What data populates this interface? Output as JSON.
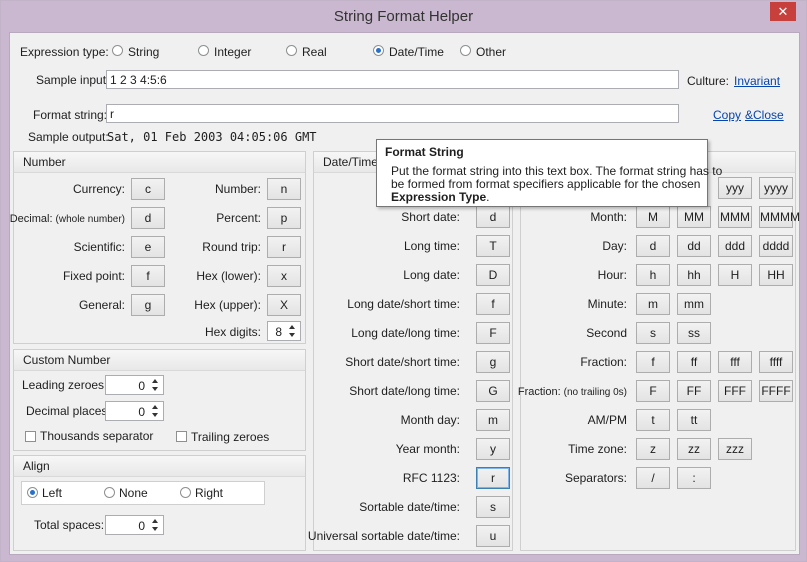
{
  "window": {
    "title": "String Format Helper",
    "close_glyph": "✕"
  },
  "expression": {
    "label": "Expression type:",
    "options": [
      {
        "label": "String",
        "selected": false
      },
      {
        "label": "Integer",
        "selected": false
      },
      {
        "label": "Real",
        "selected": false
      },
      {
        "label": "Date/Time",
        "selected": true
      },
      {
        "label": "Other",
        "selected": false
      }
    ]
  },
  "sample_input": {
    "label": "Sample input:",
    "value": "1 2 3 4:5:6"
  },
  "culture": {
    "label": "Culture:",
    "value": "Invariant"
  },
  "format_string": {
    "label": "Format string:",
    "value": "r"
  },
  "actions": {
    "copy": "Copy",
    "close": "&Close"
  },
  "sample_output": {
    "label": "Sample output:",
    "value": "Sat, 01 Feb 2003 04:05:06 GMT"
  },
  "number": {
    "title": "Number",
    "left": [
      {
        "label": "Currency:",
        "btn": "c"
      },
      {
        "label": "Decimal:",
        "sub": "(whole number)",
        "btn": "d"
      },
      {
        "label": "Scientific:",
        "btn": "e"
      },
      {
        "label": "Fixed point:",
        "btn": "f"
      },
      {
        "label": "General:",
        "btn": "g"
      }
    ],
    "right": [
      {
        "label": "Number:",
        "btn": "n"
      },
      {
        "label": "Percent:",
        "btn": "p"
      },
      {
        "label": "Round trip:",
        "btn": "r"
      },
      {
        "label": "Hex (lower):",
        "btn": "x"
      },
      {
        "label": "Hex (upper):",
        "btn": "X"
      }
    ],
    "hex_digits": {
      "label": "Hex digits:",
      "value": "8"
    }
  },
  "custom_number": {
    "title": "Custom Number",
    "leading_zeroes": {
      "label": "Leading zeroes:",
      "value": "0"
    },
    "decimal_places": {
      "label": "Decimal places:",
      "value": "0"
    },
    "thousands_separator": "Thousands separator",
    "trailing_zeroes": "Trailing zeroes"
  },
  "align": {
    "title": "Align",
    "options": [
      {
        "label": "Left",
        "selected": true
      },
      {
        "label": "None",
        "selected": false
      },
      {
        "label": "Right",
        "selected": false
      }
    ],
    "total_spaces": {
      "label": "Total spaces:",
      "value": "0"
    }
  },
  "datetime": {
    "title": "Date/Time",
    "rows": [
      {
        "label": "Short date:",
        "btn": "d"
      },
      {
        "label": "Long time:",
        "btn": "T"
      },
      {
        "label": "Long date:",
        "btn": "D"
      },
      {
        "label": "Long date/short time:",
        "btn": "f"
      },
      {
        "label": "Long date/long time:",
        "btn": "F"
      },
      {
        "label": "Short date/short time:",
        "btn": "g"
      },
      {
        "label": "Short date/long time:",
        "btn": "G"
      },
      {
        "label": "Month day:",
        "btn": "m"
      },
      {
        "label": "Year month:",
        "btn": "y"
      },
      {
        "label": "RFC 1123:",
        "btn": "r"
      },
      {
        "label": "Sortable date/time:",
        "btn": "s"
      },
      {
        "label": "Universal sortable date/time:",
        "btn": "u"
      }
    ]
  },
  "custom_datetime": {
    "year_buttons": [
      "yyy",
      "yyyy"
    ],
    "rows": [
      {
        "label": "Month:",
        "buttons": [
          "M",
          "MM",
          "MMM",
          "MMMM"
        ]
      },
      {
        "label": "Day:",
        "buttons": [
          "d",
          "dd",
          "ddd",
          "dddd"
        ]
      },
      {
        "label": "Hour:",
        "buttons": [
          "h",
          "hh",
          "H",
          "HH"
        ]
      },
      {
        "label": "Minute:",
        "buttons": [
          "m",
          "mm"
        ]
      },
      {
        "label": "Second",
        "buttons": [
          "s",
          "ss"
        ]
      },
      {
        "label": "Fraction:",
        "buttons": [
          "f",
          "ff",
          "fff",
          "ffff"
        ]
      },
      {
        "label": "Fraction:",
        "sub": "(no trailing 0s)",
        "buttons": [
          "F",
          "FF",
          "FFF",
          "FFFF"
        ]
      },
      {
        "label": "AM/PM",
        "buttons": [
          "t",
          "tt"
        ]
      },
      {
        "label": "Time zone:",
        "buttons": [
          "z",
          "zz",
          "zzz"
        ]
      },
      {
        "label": "Separators:",
        "buttons": [
          "/",
          ":"
        ]
      }
    ]
  },
  "tooltip": {
    "title": "Format String",
    "line1": "Put the format string into this text box. The format string has to",
    "line2": "be formed from format specifiers applicable for the chosen",
    "bold": "Expression Type",
    "end": "."
  }
}
